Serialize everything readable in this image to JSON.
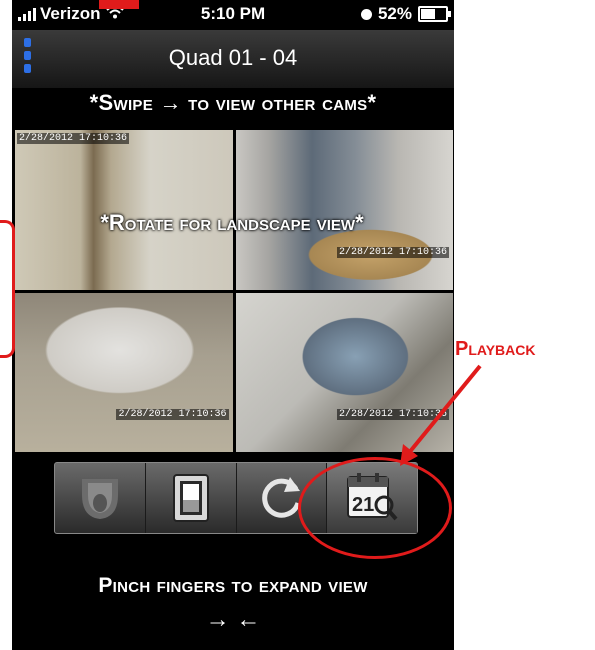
{
  "status_bar": {
    "carrier": "Verizon",
    "time": "5:10 PM",
    "battery_percent": "52%",
    "battery_level": 0.52
  },
  "header": {
    "title": "Quad 01 - 04"
  },
  "instructions": {
    "swipe": "*Swipe → to view other cams*",
    "rotate": "*Rotate for landscape view*",
    "pinch": "Pinch fingers to expand view",
    "pinch_arrows": "→ ←"
  },
  "cameras": [
    {
      "timestamp": "2/28/2012 17:10:36"
    },
    {
      "timestamp": "2/28/2012 17:10:36"
    },
    {
      "timestamp": "2/28/2012 17:10:36"
    },
    {
      "timestamp": "2/28/2012 17:10:36"
    }
  ],
  "toolbar": {
    "buttons": [
      {
        "icon": "ptz-camera-icon"
      },
      {
        "icon": "switch-icon"
      },
      {
        "icon": "refresh-icon"
      },
      {
        "icon": "playback-calendar-icon",
        "calendar_day": "21"
      }
    ]
  },
  "annotations": {
    "playback_label": "Playback",
    "highlight_color": "#e01b1b"
  },
  "colors": {
    "accent": "#2d6fe6"
  }
}
